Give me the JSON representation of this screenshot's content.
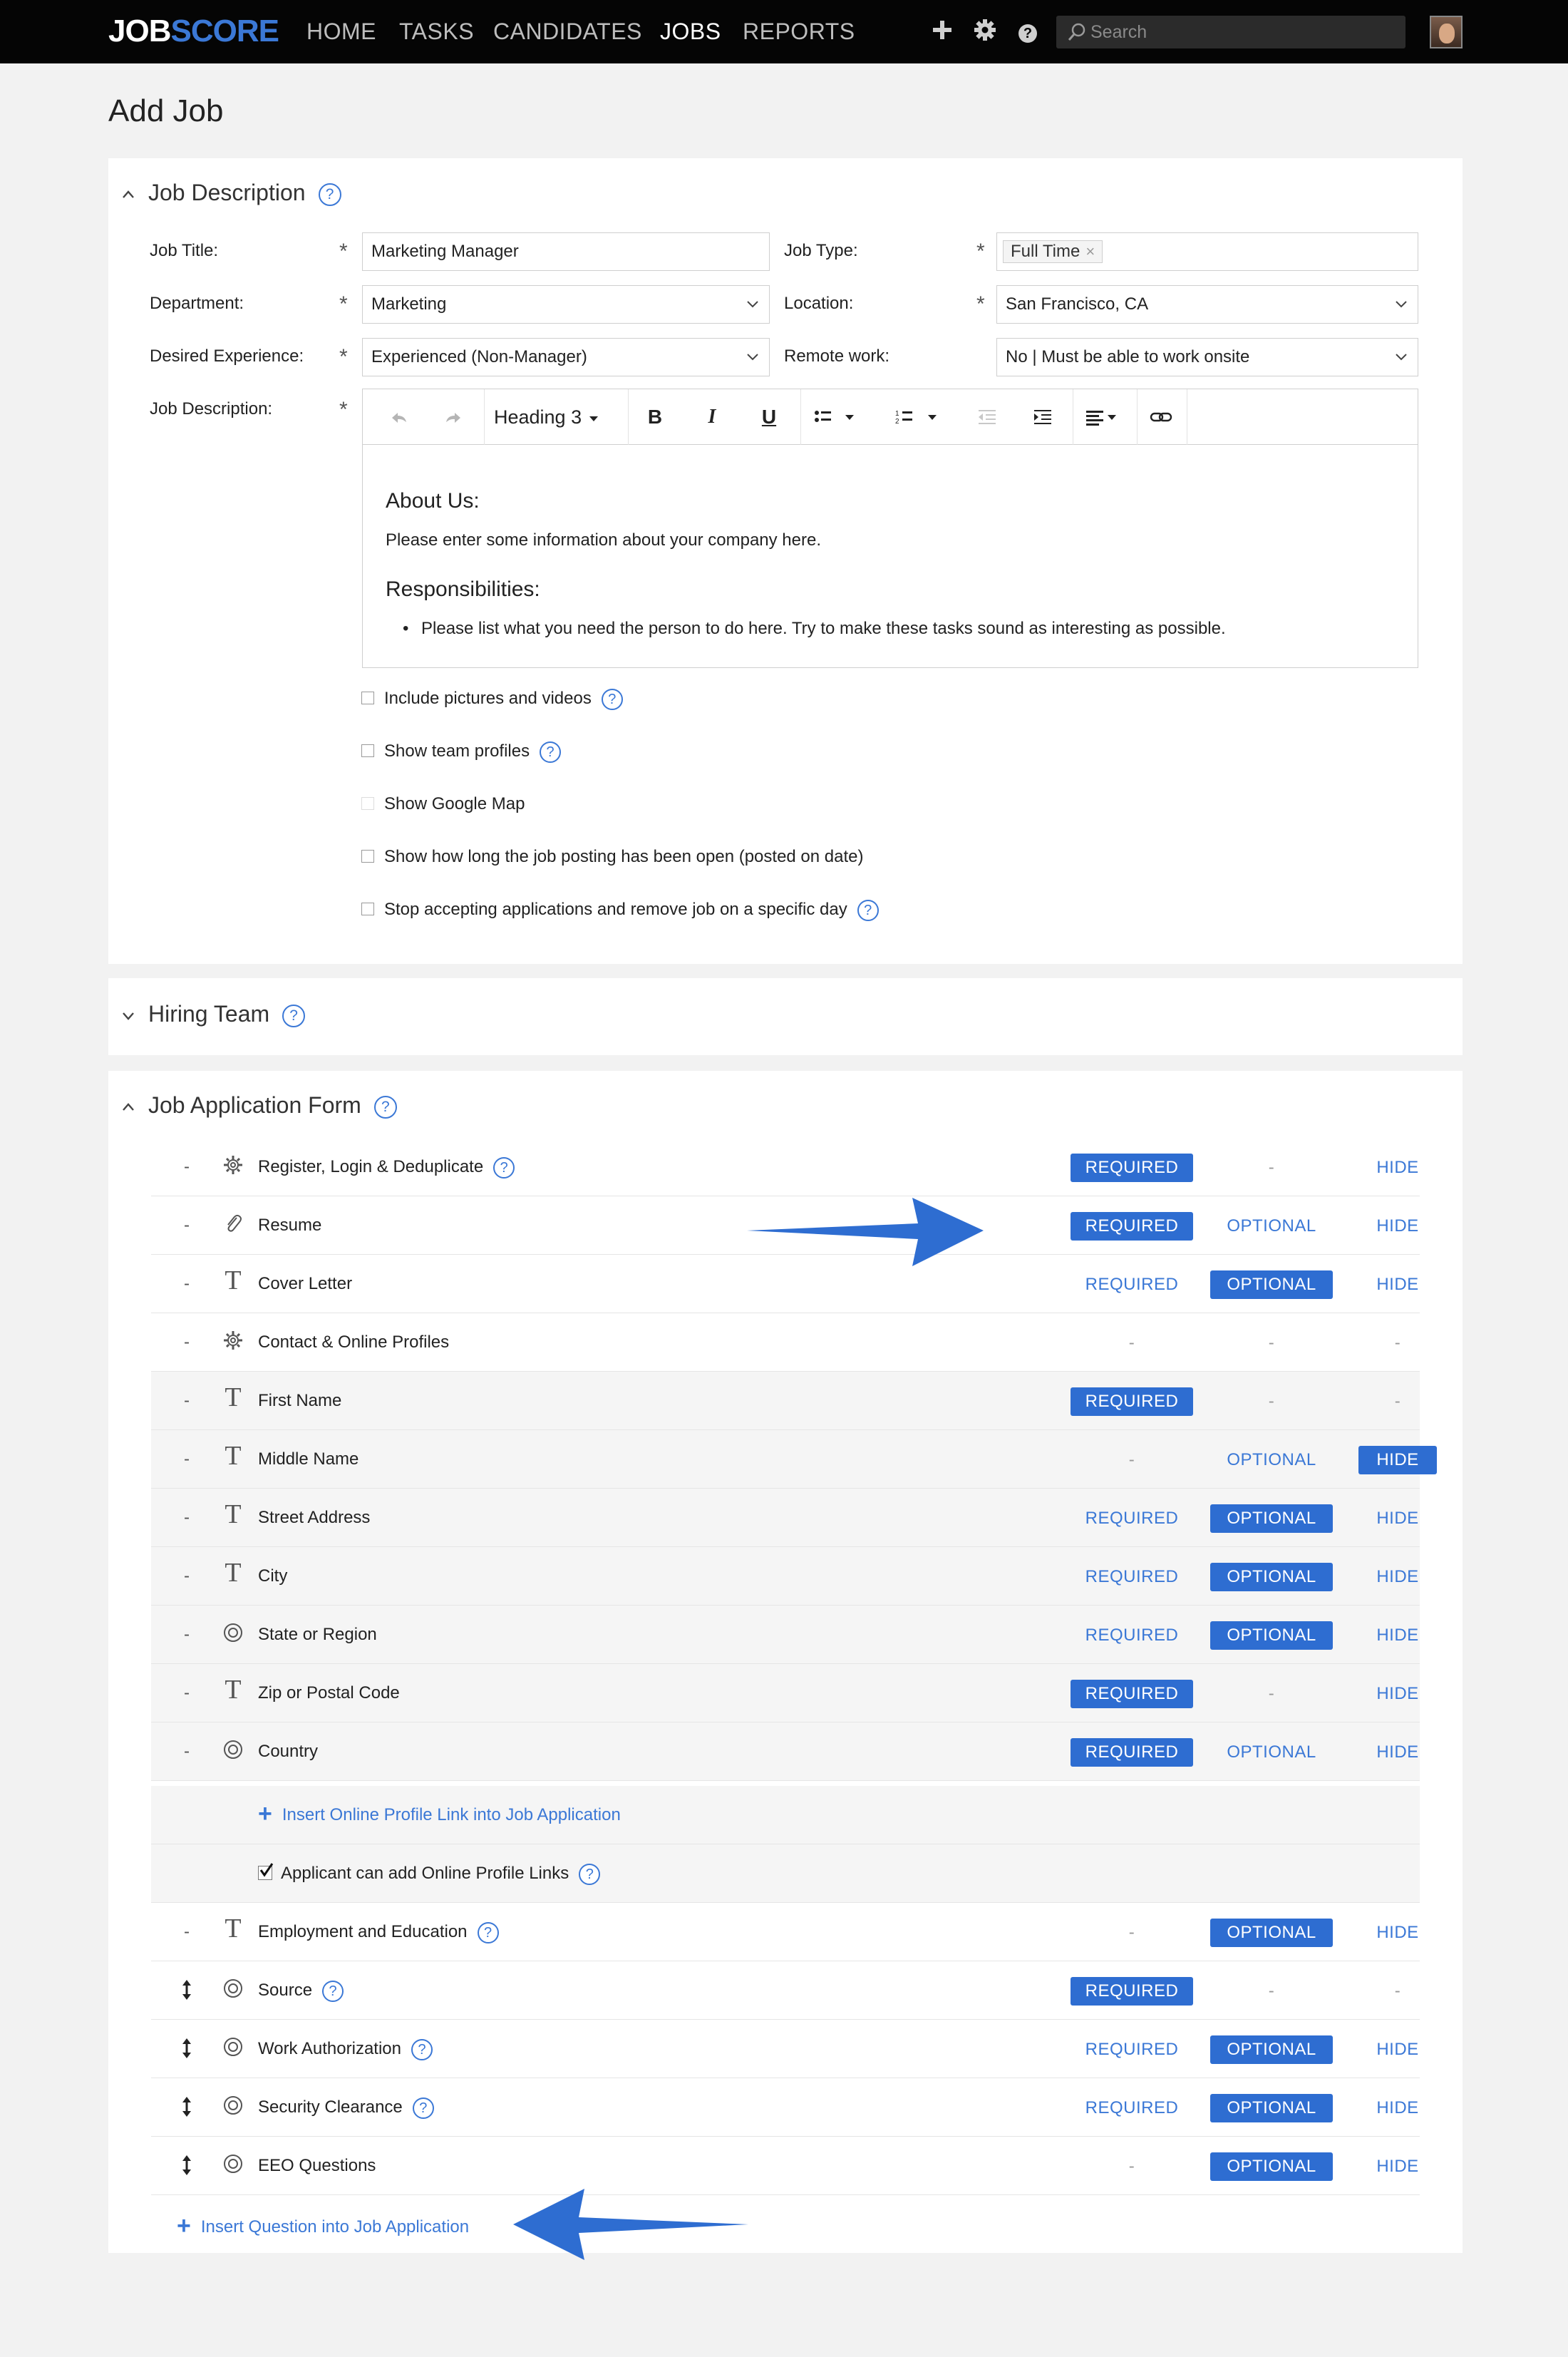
{
  "nav": {
    "logo_a": "JOB",
    "logo_b": "SCORE",
    "links": [
      "HOME",
      "TASKS",
      "CANDIDATES",
      "JOBS",
      "REPORTS"
    ],
    "active": "JOBS",
    "search_placeholder": "Search",
    "icons": [
      "plus-icon",
      "gear-icon",
      "help-icon",
      "search-icon"
    ],
    "help_glyph": "?"
  },
  "page": {
    "title": "Add Job"
  },
  "job_description": {
    "heading": "Job Description",
    "q": "?",
    "asterisk": "*",
    "fields": {
      "job_title": {
        "label": "Job Title:",
        "value": "Marketing Manager"
      },
      "job_type": {
        "label": "Job Type:",
        "value": "Full Time",
        "remove": "×"
      },
      "department": {
        "label": "Department:",
        "value": "Marketing"
      },
      "location": {
        "label": "Location:",
        "value": "San Francisco, CA"
      },
      "experience": {
        "label": "Desired Experience:",
        "value": "Experienced (Non-Manager)"
      },
      "remote": {
        "label": "Remote work:",
        "value": "No | Must be able to work onsite"
      },
      "description": {
        "label": "Job Description:"
      }
    },
    "editor": {
      "heading_select": "Heading 3",
      "bold": "B",
      "italic": "I",
      "underline": "U",
      "about_heading": "About Us:",
      "about_text": "Please enter some information about your company here.",
      "resp_heading": "Responsibilities:",
      "resp_item": "Please list what you need the person to do here.  Try to make these tasks sound as interesting as possible."
    },
    "options": [
      {
        "label": "Include pictures and videos",
        "help": true,
        "disabled": false
      },
      {
        "label": "Show team profiles",
        "help": true,
        "disabled": false
      },
      {
        "label": "Show Google Map",
        "help": false,
        "disabled": true
      },
      {
        "label": "Show how long the job posting has been open (posted on date)",
        "help": false,
        "disabled": false
      },
      {
        "label": "Stop accepting applications and remove job on a specific day",
        "help": true,
        "disabled": false
      }
    ]
  },
  "hiring_team": {
    "heading": "Hiring Team"
  },
  "application_form": {
    "heading": "Job Application Form",
    "dash": "-",
    "labels": {
      "required": "REQUIRED",
      "optional": "OPTIONAL",
      "hide": "HIDE"
    },
    "rows": [
      {
        "name": "Register, Login & Deduplicate",
        "icon": "gear-icon",
        "lead": "dash",
        "help": true,
        "shade": false,
        "req": "on",
        "opt": "none",
        "hide": "link"
      },
      {
        "name": "Resume",
        "icon": "paperclip-icon",
        "lead": "dash",
        "help": false,
        "shade": false,
        "req": "on",
        "opt": "link",
        "hide": "link"
      },
      {
        "name": "Cover Letter",
        "icon": "text-icon",
        "lead": "dash",
        "help": false,
        "shade": false,
        "req": "link",
        "opt": "on",
        "hide": "link"
      },
      {
        "name": "Contact & Online Profiles",
        "icon": "gear-icon",
        "lead": "dash",
        "help": false,
        "shade": false,
        "req": "none",
        "opt": "none",
        "hide": "none"
      },
      {
        "name": "First Name",
        "icon": "text-icon",
        "lead": "dash",
        "help": false,
        "shade": true,
        "req": "on",
        "opt": "none",
        "hide": "none"
      },
      {
        "name": "Middle Name",
        "icon": "text-icon",
        "lead": "dash",
        "help": false,
        "shade": true,
        "req": "none",
        "opt": "link",
        "hide": "on"
      },
      {
        "name": "Street Address",
        "icon": "text-icon",
        "lead": "dash",
        "help": false,
        "shade": true,
        "req": "link",
        "opt": "on",
        "hide": "link"
      },
      {
        "name": "City",
        "icon": "text-icon",
        "lead": "dash",
        "help": false,
        "shade": true,
        "req": "link",
        "opt": "on",
        "hide": "link"
      },
      {
        "name": "State or Region",
        "icon": "radio-icon",
        "lead": "dash",
        "help": false,
        "shade": true,
        "req": "link",
        "opt": "on",
        "hide": "link"
      },
      {
        "name": "Zip or Postal Code",
        "icon": "text-icon",
        "lead": "dash",
        "help": false,
        "shade": true,
        "req": "on",
        "opt": "none",
        "hide": "link"
      },
      {
        "name": "Country",
        "icon": "radio-icon",
        "lead": "dash",
        "help": false,
        "shade": true,
        "req": "on",
        "opt": "link",
        "hide": "link"
      }
    ],
    "insert_profile_link": "Insert Online Profile Link into Job Application",
    "applicant_profile_links": "Applicant can add Online Profile Links",
    "rows2": [
      {
        "name": "Employment and Education",
        "icon": "text-icon",
        "lead": "dash",
        "help": true,
        "shade": false,
        "req": "none",
        "opt": "on",
        "hide": "link"
      },
      {
        "name": "Source",
        "icon": "radio-icon",
        "lead": "drag",
        "help": true,
        "shade": false,
        "req": "on",
        "opt": "none",
        "hide": "none"
      },
      {
        "name": "Work Authorization",
        "icon": "radio-icon",
        "lead": "drag",
        "help": true,
        "shade": false,
        "req": "link",
        "opt": "on",
        "hide": "link"
      },
      {
        "name": "Security Clearance",
        "icon": "radio-icon",
        "lead": "drag",
        "help": true,
        "shade": false,
        "req": "link",
        "opt": "on",
        "hide": "link"
      },
      {
        "name": "EEO Questions",
        "icon": "radio-icon",
        "lead": "drag",
        "help": false,
        "shade": false,
        "req": "none",
        "opt": "on",
        "hide": "link"
      }
    ],
    "insert_question": "Insert Question into Job Application"
  },
  "colors": {
    "accent": "#2e6dd1",
    "link": "#3b78d6",
    "nav_bg": "#050505",
    "logo_score": "#3b78d6"
  }
}
